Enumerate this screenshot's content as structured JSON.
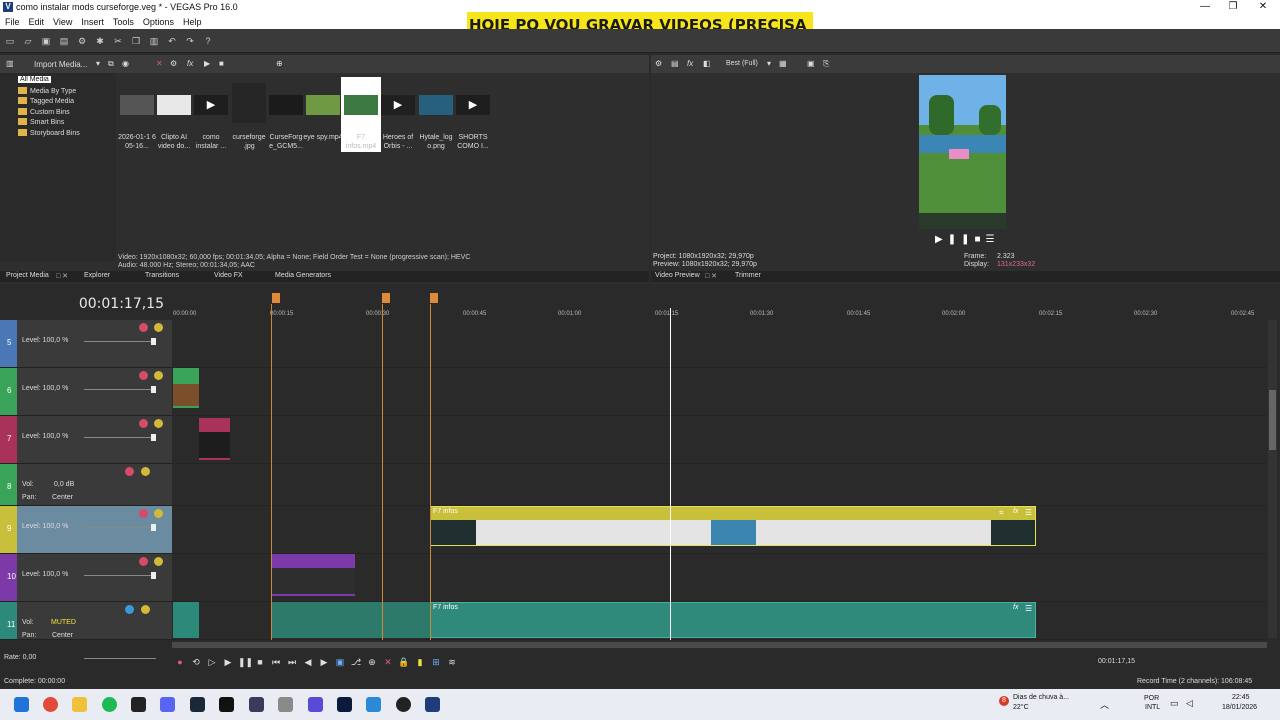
{
  "window": {
    "title": "como instalar mods curseforge.veg * - VEGAS Pro 16.0",
    "overlay_banner": "HOJE PQ VOU GRAVAR VIDEOS (PRECISA ES",
    "controls": [
      "—",
      "❐",
      "✕"
    ]
  },
  "menu": [
    "File",
    "Edit",
    "View",
    "Insert",
    "Tools",
    "Options",
    "Help"
  ],
  "project_media": {
    "import_label": "Import Media...",
    "tree": [
      "All Media",
      "Media By Type",
      "Tagged Media",
      "Custom Bins",
      "Smart Bins",
      "Storyboard Bins"
    ],
    "items": [
      {
        "label": "2026-01-1 6 05-16...",
        "color": "#555555"
      },
      {
        "label": "Clipto AI video do...",
        "color": "#e8e8e8"
      },
      {
        "label": "como instalar ...",
        "color": "#1e1e1e"
      },
      {
        "label": "curseforge .jpg",
        "color": "#262626"
      },
      {
        "label": "CurseForg e_GCM5...",
        "color": "#1b1b1b"
      },
      {
        "label": "eye spy.mp4",
        "color": "#6f9a43"
      },
      {
        "label": "F7 infos.mp4",
        "color": "#3c7a42"
      },
      {
        "label": "Heroes of Orbis - ...",
        "color": "#202020"
      },
      {
        "label": "Hytale_log o.png",
        "color": "#27607f"
      },
      {
        "label": "SHORTS COMO I...",
        "color": "#1e1e1e"
      }
    ],
    "status_line1": "Video: 1920x1080x32; 60,000 fps; 00:01:34,05; Alpha = None; Field Order Test = None (progressive scan); HEVC",
    "status_line2": "Audio: 48.000 Hz; Stereo; 00:01:34,05; AAC",
    "tabs": [
      "Project Media",
      "Explorer",
      "Transitions",
      "Video FX",
      "Media Generators"
    ]
  },
  "video_preview": {
    "quality": "Best (Full)",
    "project": "Project: 1080x1920x32; 29,970p",
    "preview": "Preview: 1080x1920x32; 29,970p",
    "frame_label": "Frame:",
    "frame_value": "2.323",
    "display_label": "Display:",
    "display_value": "131x233x32",
    "tabs": [
      "Video Preview",
      "Trimmer"
    ]
  },
  "timeline": {
    "current_time": "00:01:17,15",
    "ruler_labels": [
      "00:00:00",
      "00:00:15",
      "00:00:30",
      "00:00:45",
      "00:01:00",
      "00:01:15",
      "00:01:30",
      "00:01:45",
      "00:02:00",
      "00:02:15",
      "00:02:30",
      "00:02:45"
    ],
    "tracks": [
      {
        "num": "5",
        "label": "Level: 100,0 %",
        "color": "#4a77b5"
      },
      {
        "num": "6",
        "label": "Level: 100,0 %",
        "color": "#3aa35a"
      },
      {
        "num": "7",
        "label": "Level: 100,0 %",
        "color": "#a8325a"
      },
      {
        "num": "8",
        "label": "Vol:",
        "value": "0,0 dB",
        "pan_label": "Pan:",
        "pan_value": "Center",
        "color": "#3aa35a"
      },
      {
        "num": "9",
        "label": "Level: 100,0 %",
        "color": "#c8bf3a"
      },
      {
        "num": "10",
        "label": "Level: 100,0 %",
        "color": "#7b3aa8"
      },
      {
        "num": "11",
        "label": "Vol:",
        "value": "MUTED",
        "pan_label": "Pan:",
        "pan_value": "Center",
        "color": "#2d8a7a"
      }
    ],
    "clip_video_label": "F7 infos",
    "clip_audio_label": "F7 infos",
    "rate": "Rate: 0,00",
    "transport_time": "00:01:17,15"
  },
  "status": {
    "left": "Complete: 00:00:00",
    "right": "Record Time (2 channels): 106:08:45"
  },
  "taskbar": {
    "weather_title": "Dias de chuva à...",
    "weather_temp": "22°C",
    "lang1": "POR",
    "lang2": "INTL",
    "time": "22:45",
    "date": "18/01/2026",
    "badge": "8"
  }
}
